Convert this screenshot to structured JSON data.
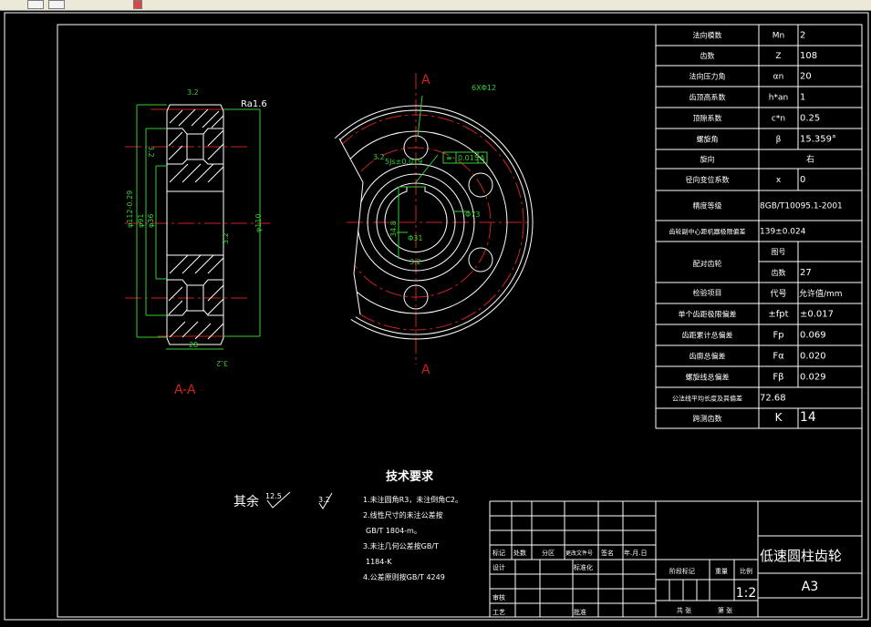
{
  "params_table": [
    {
      "name": "法向模数",
      "symbol": "Mn",
      "value": "2"
    },
    {
      "name": "齿数",
      "symbol": "Z",
      "value": "108"
    },
    {
      "name": "法向压力角",
      "symbol": "αn",
      "value": "20"
    },
    {
      "name": "齿顶高系数",
      "symbol": "h*an",
      "value": "1"
    },
    {
      "name": "顶隙系数",
      "symbol": "c*n",
      "value": "0.25"
    },
    {
      "name": "螺旋角",
      "symbol": "β",
      "value": "15.359°"
    },
    {
      "name": "旋向",
      "value": "右"
    },
    {
      "name": "径向变位系数",
      "symbol": "x",
      "value": "0"
    },
    {
      "name": "精度等级",
      "value": "8GB/T10095.1-2001"
    },
    {
      "name": "齿轮副中心距机器极限偏差",
      "value": "139±0.024"
    }
  ],
  "mating_gear": {
    "label": "配对齿轮",
    "drawing_no_label": "图号",
    "drawing_no": "",
    "teeth_label": "齿数",
    "teeth": "27"
  },
  "inspection": {
    "label": "检验项目",
    "code_label": "代号",
    "allow_label": "允许值/mm",
    "rows": [
      {
        "name": "单个齿距极限偏差",
        "symbol": "±fpt",
        "value": "±0.017"
      },
      {
        "name": "齿距累计总偏差",
        "symbol": "Fp",
        "value": "0.069"
      },
      {
        "name": "齿廓总偏差",
        "symbol": "Fα",
        "value": "0.020"
      },
      {
        "name": "螺旋线总偏差",
        "symbol": "Fβ",
        "value": "0.029"
      },
      {
        "name": "公法线平均长度及其偏差",
        "value": "72.68"
      },
      {
        "name": "跨测齿数",
        "symbol": "K",
        "value": "14"
      }
    ]
  },
  "title_block": {
    "mark": "标记",
    "count": "处数",
    "zone": "分区",
    "doc_no": "更改文件号",
    "sign": "签名",
    "date": "年.月.日",
    "design": "设计",
    "standard": "标准化",
    "review": "审核",
    "process": "工艺",
    "approve": "批准",
    "stage": "阶段标记",
    "weight": "重量",
    "scale_label": "比例",
    "scale": "1:2",
    "sheets": "共   张",
    "sheet_no": "第   张",
    "part_name": "低速圆柱齿轮",
    "paper_size": "A3"
  },
  "tech_req": {
    "title": "技术要求",
    "items": [
      "1.未注圆角R3，未注倒角C2。",
      "2.线性尺寸的未注公差按",
      "GB/T 1804-m。",
      "3.未注几何公差按GB/T",
      "1184-K",
      "4.公差原则按GB/T 4249"
    ]
  },
  "roughness": {
    "rest_label": "其余",
    "rest_value": "12.5",
    "other": "3.2"
  },
  "section_view": {
    "label": "A-A",
    "dims": [
      "φ112-0.29",
      "φ91",
      "φ36",
      "φ110",
      "28",
      "3.2",
      "3.2",
      "3.2",
      "3.2",
      "Ra1.6"
    ]
  },
  "front_view": {
    "holes": "6XΦ12",
    "keyway": "5Js±0.019",
    "tolerance": "0.015",
    "datum": "A",
    "pcd": "Φ73",
    "bore": "Φ31",
    "key_depth": "34.8",
    "cut_label": "A",
    "rough": "3.2"
  },
  "colors": {
    "background": "#000000",
    "outline": "#ffffff",
    "dimension": "#33cc33",
    "centerline": "#cc2222"
  }
}
